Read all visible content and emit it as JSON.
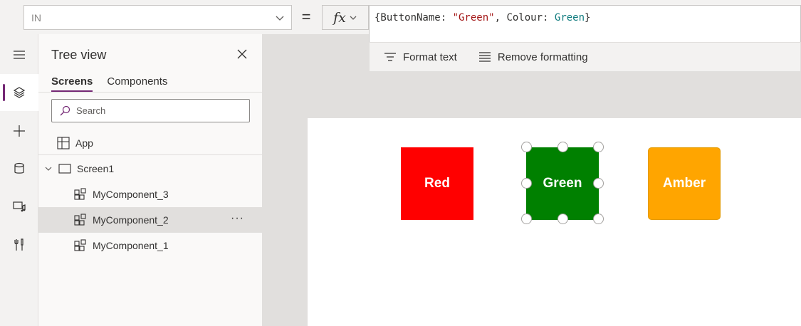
{
  "formula_bar": {
    "property": "IN",
    "equals": "=",
    "fx_label": "fx",
    "formula_parts": {
      "open": "{ButtonName: ",
      "name_value": "\"Green\"",
      "mid": ", Colour: ",
      "colour_value": "Green",
      "close": "}"
    },
    "format_text_label": "Format text",
    "remove_formatting_label": "Remove formatting"
  },
  "tree_view": {
    "title": "Tree view",
    "tabs": [
      "Screens",
      "Components"
    ],
    "active_tab": "Screens",
    "search_placeholder": "Search",
    "items": [
      {
        "label": "App",
        "icon": "app-icon",
        "level": 0
      },
      {
        "label": "Screen1",
        "icon": "screen-icon",
        "level": 0,
        "expanded": true
      },
      {
        "label": "MyComponent_3",
        "icon": "component-icon",
        "level": 1
      },
      {
        "label": "MyComponent_2",
        "icon": "component-icon",
        "level": 1,
        "selected": true
      },
      {
        "label": "MyComponent_1",
        "icon": "component-icon",
        "level": 1
      }
    ],
    "more_label": "···"
  },
  "left_rail": [
    "hamburger-icon",
    "layers-icon",
    "plus-icon",
    "database-icon",
    "media-icon",
    "tools-icon"
  ],
  "canvas": {
    "buttons": [
      {
        "label": "Red",
        "color": "#ff0000"
      },
      {
        "label": "Green",
        "color": "#008000",
        "selected": true
      },
      {
        "label": "Amber",
        "color": "#ffa500"
      }
    ]
  },
  "colors": {
    "accent": "#742774",
    "string": "#a31515",
    "keyword": "#0f7b7e"
  }
}
